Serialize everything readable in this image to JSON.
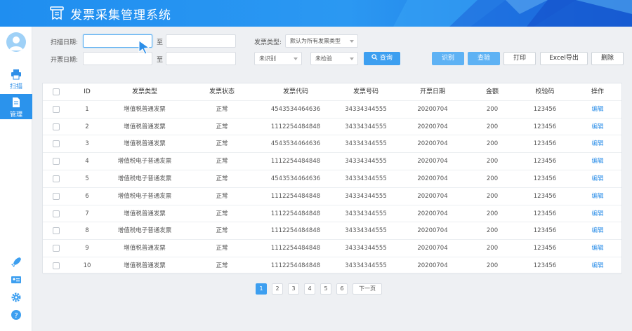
{
  "app": {
    "title": "发票采集管理系统"
  },
  "sidebar": {
    "items": [
      {
        "label": "扫描",
        "icon": "printer-icon"
      },
      {
        "label": "管理",
        "icon": "document-icon"
      }
    ],
    "bottom_icons": [
      "rocket-icon",
      "id-card-icon",
      "gear-icon",
      "help-icon"
    ]
  },
  "filters": {
    "scan_date_label": "扫描日期:",
    "issue_date_label": "开票日期:",
    "to_label": "至",
    "invoice_type_label": "发票类型:",
    "invoice_type_value": "默认为所有发票类型",
    "recognition_value": "未识别",
    "verification_value": "未检验",
    "search_label": "查询"
  },
  "actions": {
    "recognize": "识别",
    "verify": "查验",
    "print": "打印",
    "export": "Excel导出",
    "delete": "删除"
  },
  "table": {
    "headers": [
      "ID",
      "发票类型",
      "发票状态",
      "发票代码",
      "发票号码",
      "开票日期",
      "金额",
      "校验码",
      "操作"
    ],
    "rows": [
      {
        "id": "1",
        "type": "增值税普通发票",
        "status": "正常",
        "code": "4543534464636",
        "number": "34334344555",
        "date": "20200704",
        "amount": "200",
        "check": "123456",
        "op": "编辑"
      },
      {
        "id": "2",
        "type": "增值税普通发票",
        "status": "正常",
        "code": "1112254484848",
        "number": "34334344555",
        "date": "20200704",
        "amount": "200",
        "check": "123456",
        "op": "编辑"
      },
      {
        "id": "3",
        "type": "增值税普通发票",
        "status": "正常",
        "code": "4543534464636",
        "number": "34334344555",
        "date": "20200704",
        "amount": "200",
        "check": "123456",
        "op": "编辑"
      },
      {
        "id": "4",
        "type": "增值税电子普通发票",
        "status": "正常",
        "code": "1112254484848",
        "number": "34334344555",
        "date": "20200704",
        "amount": "200",
        "check": "123456",
        "op": "编辑"
      },
      {
        "id": "5",
        "type": "增值税电子普通发票",
        "status": "正常",
        "code": "4543534464636",
        "number": "34334344555",
        "date": "20200704",
        "amount": "200",
        "check": "123456",
        "op": "编辑"
      },
      {
        "id": "6",
        "type": "增值税电子普通发票",
        "status": "正常",
        "code": "1112254484848",
        "number": "34334344555",
        "date": "20200704",
        "amount": "200",
        "check": "123456",
        "op": "编辑"
      },
      {
        "id": "7",
        "type": "增值税普通发票",
        "status": "正常",
        "code": "1112254484848",
        "number": "34334344555",
        "date": "20200704",
        "amount": "200",
        "check": "123456",
        "op": "编辑"
      },
      {
        "id": "8",
        "type": "增值税电子普通发票",
        "status": "正常",
        "code": "1112254484848",
        "number": "34334344555",
        "date": "20200704",
        "amount": "200",
        "check": "123456",
        "op": "编辑"
      },
      {
        "id": "9",
        "type": "增值税普通发票",
        "status": "正常",
        "code": "1112254484848",
        "number": "34334344555",
        "date": "20200704",
        "amount": "200",
        "check": "123456",
        "op": "编辑"
      },
      {
        "id": "10",
        "type": "增值税普通发票",
        "status": "正常",
        "code": "1112254484848",
        "number": "34334344555",
        "date": "20200704",
        "amount": "200",
        "check": "123456",
        "op": "编辑"
      }
    ]
  },
  "pagination": {
    "pages": [
      "1",
      "2",
      "3",
      "4",
      "5",
      "6"
    ],
    "current": "1",
    "next_label": "下一页"
  },
  "colors": {
    "header": "#2b98f2",
    "accent": "#3d9ff0",
    "link": "#2b8ee8"
  }
}
